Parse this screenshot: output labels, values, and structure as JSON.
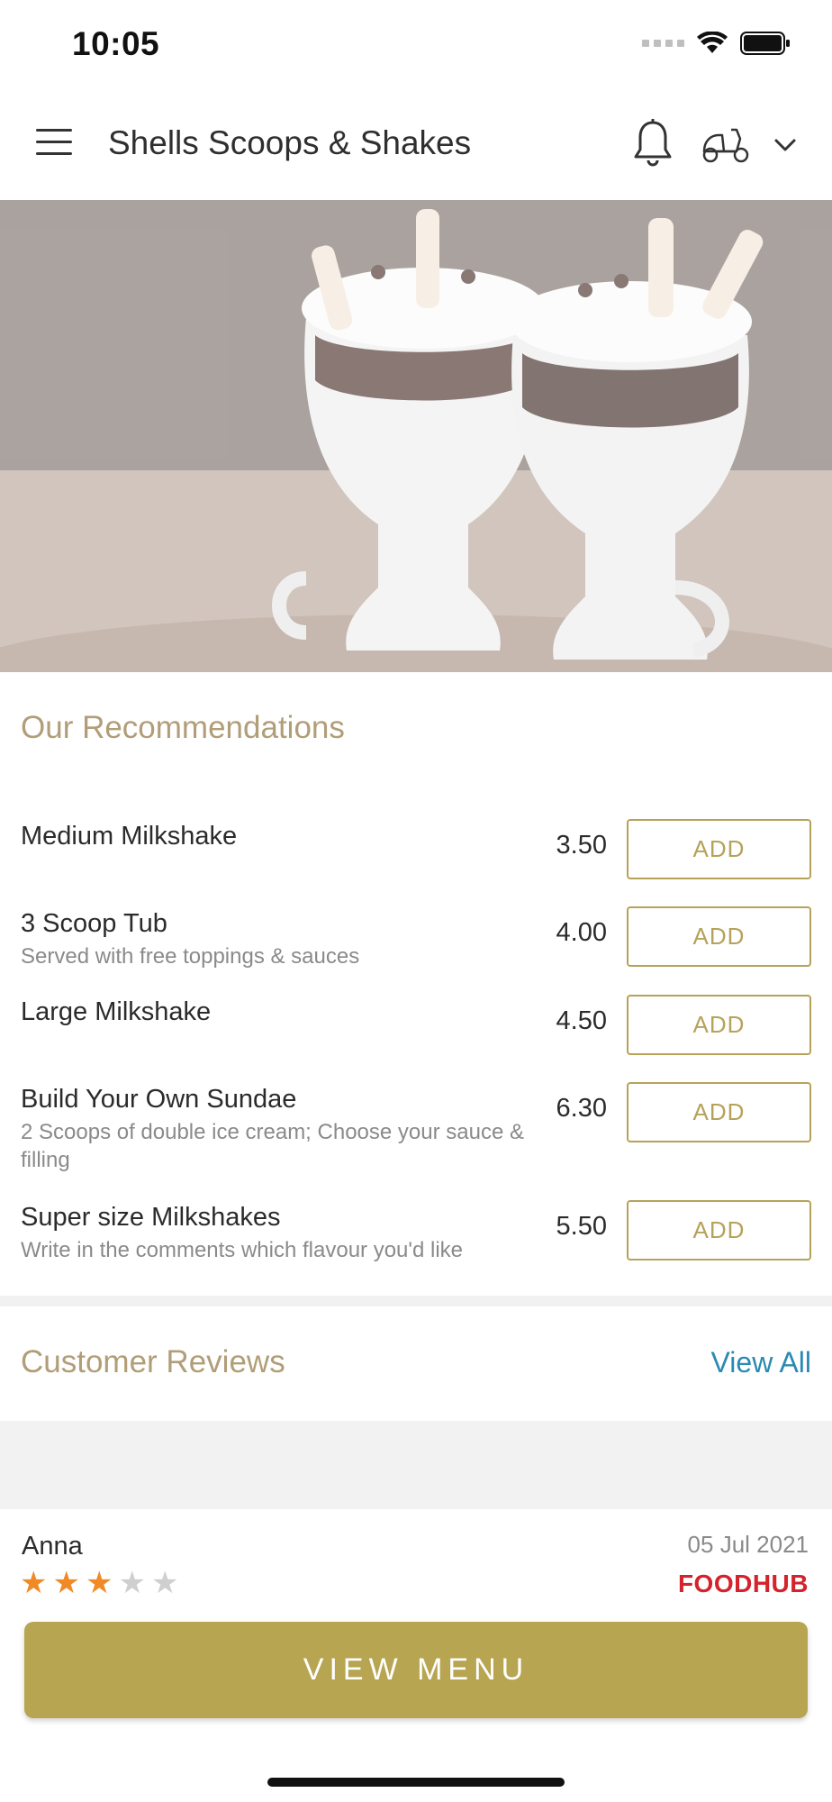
{
  "status_bar": {
    "time": "10:05"
  },
  "header": {
    "title": "Shells Scoops & Shakes"
  },
  "recommendations": {
    "title": "Our Recommendations",
    "items": [
      {
        "name": "Medium Milkshake",
        "description": "",
        "price": "3.50",
        "button": "ADD"
      },
      {
        "name": "3 Scoop Tub",
        "description": "Served with free toppings & sauces",
        "price": "4.00",
        "button": "ADD"
      },
      {
        "name": "Large Milkshake",
        "description": "",
        "price": "4.50",
        "button": "ADD"
      },
      {
        "name": "Build Your Own Sundae",
        "description": "2 Scoops of double ice cream; Choose your sauce & filling",
        "price": "6.30",
        "button": "ADD"
      },
      {
        "name": "Super size Milkshakes",
        "description": "Write in the comments which flavour you'd like",
        "price": "5.50",
        "button": "ADD"
      }
    ]
  },
  "reviews": {
    "title": "Customer Reviews",
    "view_all": "View All",
    "items": [
      {
        "name": "Anna",
        "date": "05 Jul 2021",
        "rating": 3,
        "max_rating": 5,
        "source": "FOODHUB"
      }
    ]
  },
  "view_menu_label": "VIEW MENU",
  "colors": {
    "accent": "#b8a551",
    "section_title": "#b19e78",
    "link": "#2a8ab4",
    "star": "#f08a26",
    "foodhub": "#d4232b"
  }
}
